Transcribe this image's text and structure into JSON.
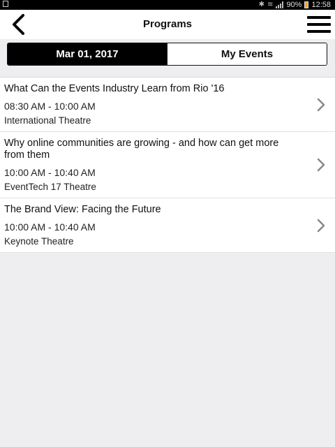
{
  "status_bar": {
    "battery_percent": "90%",
    "time": "12:58",
    "icons": [
      "notification-icon",
      "bluetooth-icon",
      "wifi-icon",
      "signal-icon",
      "battery-icon"
    ]
  },
  "header": {
    "title": "Programs",
    "back_icon": "chevron-left-icon",
    "menu_icon": "hamburger-menu-icon"
  },
  "segments": [
    {
      "label": "Mar 01, 2017",
      "active": true
    },
    {
      "label": "My Events",
      "active": false
    }
  ],
  "programs": [
    {
      "title": "What Can the Events Industry Learn from Rio '16",
      "time": "08:30 AM - 10:00 AM",
      "venue": "International Theatre"
    },
    {
      "title": "Why online communities are growing - and how can get more from them",
      "time": "10:00 AM - 10:40 AM",
      "venue": "EventTech 17 Theatre"
    },
    {
      "title": "The Brand View: Facing the Future",
      "time": "10:00 AM - 10:40 AM",
      "venue": "Keynote Theatre"
    }
  ],
  "colors": {
    "active_segment": "#000000",
    "background": "#eeeef1",
    "chevron": "#888888"
  }
}
